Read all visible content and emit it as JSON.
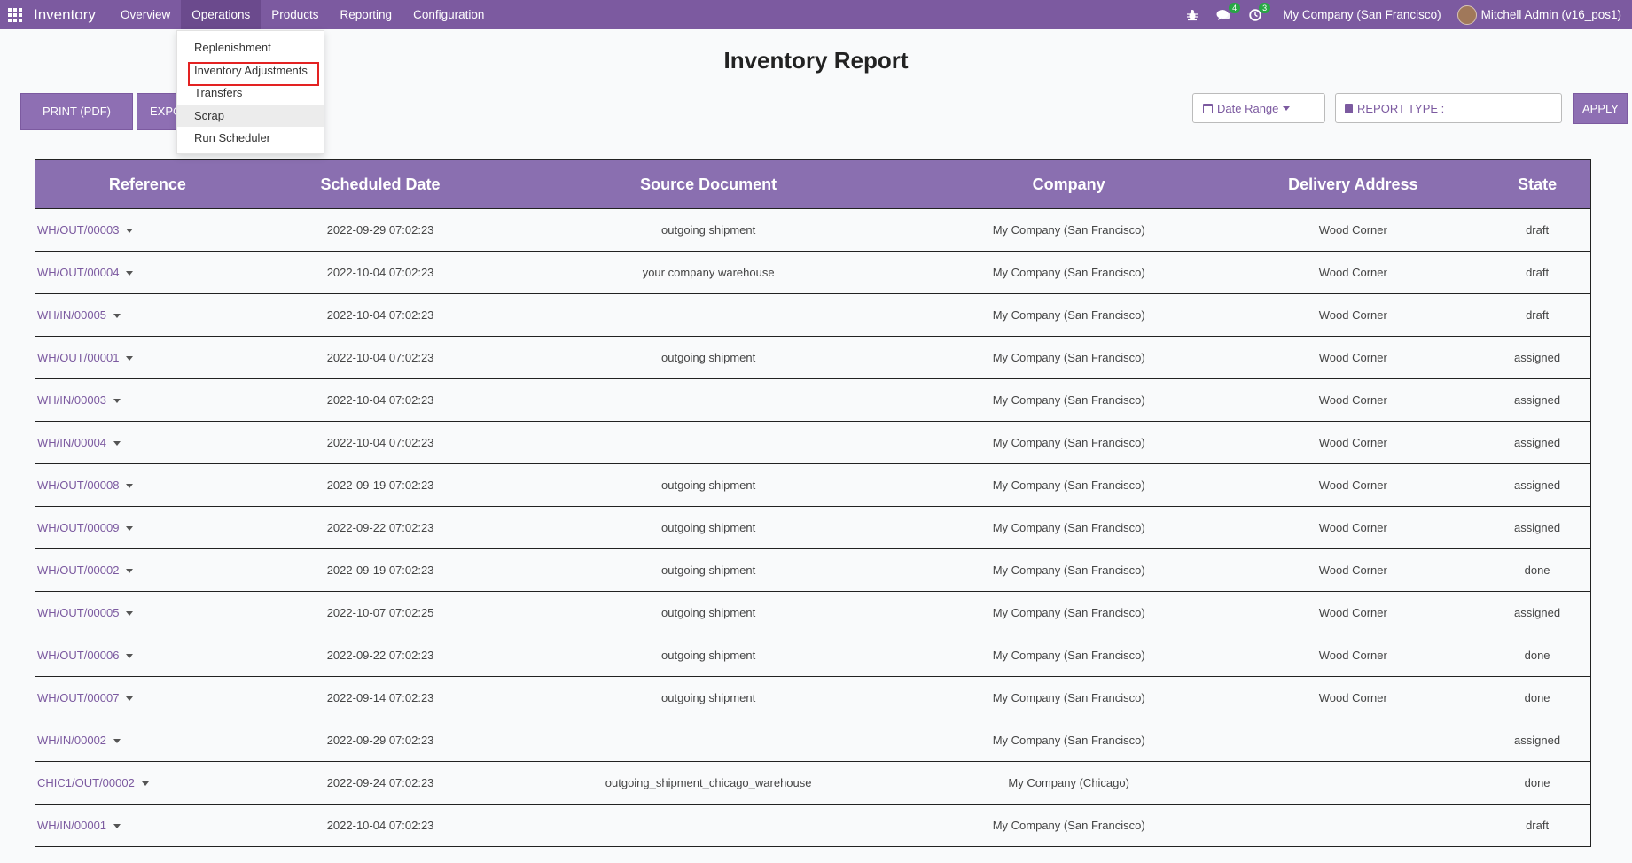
{
  "navbar": {
    "app_name": "Inventory",
    "menu": [
      "Overview",
      "Operations",
      "Products",
      "Reporting",
      "Configuration"
    ],
    "active_menu": "Operations",
    "messages_count": "4",
    "activities_count": "3",
    "company": "My Company (San Francisco)",
    "user": "Mitchell Admin (v16_pos1)"
  },
  "operations_dropdown": {
    "items": [
      "Replenishment",
      "Inventory Adjustments",
      "Transfers",
      "Scrap",
      "Run Scheduler"
    ],
    "highlighted": "Inventory Adjustments",
    "hovered": "Scrap"
  },
  "report": {
    "title": "Inventory Report",
    "print_label": "PRINT (PDF)",
    "export_label": "EXPO",
    "date_range_label": "Date Range",
    "report_type_label": "REPORT TYPE :",
    "apply_label": "APPLY"
  },
  "table": {
    "columns": [
      "Reference",
      "Scheduled Date",
      "Source Document",
      "Company",
      "Delivery Address",
      "State"
    ],
    "rows": [
      [
        "WH/OUT/00003",
        "2022-09-29 07:02:23",
        "outgoing shipment",
        "My Company (San Francisco)",
        "Wood Corner",
        "draft"
      ],
      [
        "WH/OUT/00004",
        "2022-10-04 07:02:23",
        "your company warehouse",
        "My Company (San Francisco)",
        "Wood Corner",
        "draft"
      ],
      [
        "WH/IN/00005",
        "2022-10-04 07:02:23",
        "",
        "My Company (San Francisco)",
        "Wood Corner",
        "draft"
      ],
      [
        "WH/OUT/00001",
        "2022-10-04 07:02:23",
        "outgoing shipment",
        "My Company (San Francisco)",
        "Wood Corner",
        "assigned"
      ],
      [
        "WH/IN/00003",
        "2022-10-04 07:02:23",
        "",
        "My Company (San Francisco)",
        "Wood Corner",
        "assigned"
      ],
      [
        "WH/IN/00004",
        "2022-10-04 07:02:23",
        "",
        "My Company (San Francisco)",
        "Wood Corner",
        "assigned"
      ],
      [
        "WH/OUT/00008",
        "2022-09-19 07:02:23",
        "outgoing shipment",
        "My Company (San Francisco)",
        "Wood Corner",
        "assigned"
      ],
      [
        "WH/OUT/00009",
        "2022-09-22 07:02:23",
        "outgoing shipment",
        "My Company (San Francisco)",
        "Wood Corner",
        "assigned"
      ],
      [
        "WH/OUT/00002",
        "2022-09-19 07:02:23",
        "outgoing shipment",
        "My Company (San Francisco)",
        "Wood Corner",
        "done"
      ],
      [
        "WH/OUT/00005",
        "2022-10-07 07:02:25",
        "outgoing shipment",
        "My Company (San Francisco)",
        "Wood Corner",
        "assigned"
      ],
      [
        "WH/OUT/00006",
        "2022-09-22 07:02:23",
        "outgoing shipment",
        "My Company (San Francisco)",
        "Wood Corner",
        "done"
      ],
      [
        "WH/OUT/00007",
        "2022-09-14 07:02:23",
        "outgoing shipment",
        "My Company (San Francisco)",
        "Wood Corner",
        "done"
      ],
      [
        "WH/IN/00002",
        "2022-09-29 07:02:23",
        "",
        "My Company (San Francisco)",
        "",
        "assigned"
      ],
      [
        "CHIC1/OUT/00002",
        "2022-09-24 07:02:23",
        "outgoing_shipment_chicago_warehouse",
        "My Company (Chicago)",
        "",
        "done"
      ],
      [
        "WH/IN/00001",
        "2022-10-04 07:02:23",
        "",
        "My Company (San Francisco)",
        "",
        "draft"
      ]
    ]
  },
  "colors": {
    "navbar": "#7c5aa0",
    "table_header": "#8a6fb0",
    "highlight_box": "#e32222",
    "badge": "#28a745"
  }
}
